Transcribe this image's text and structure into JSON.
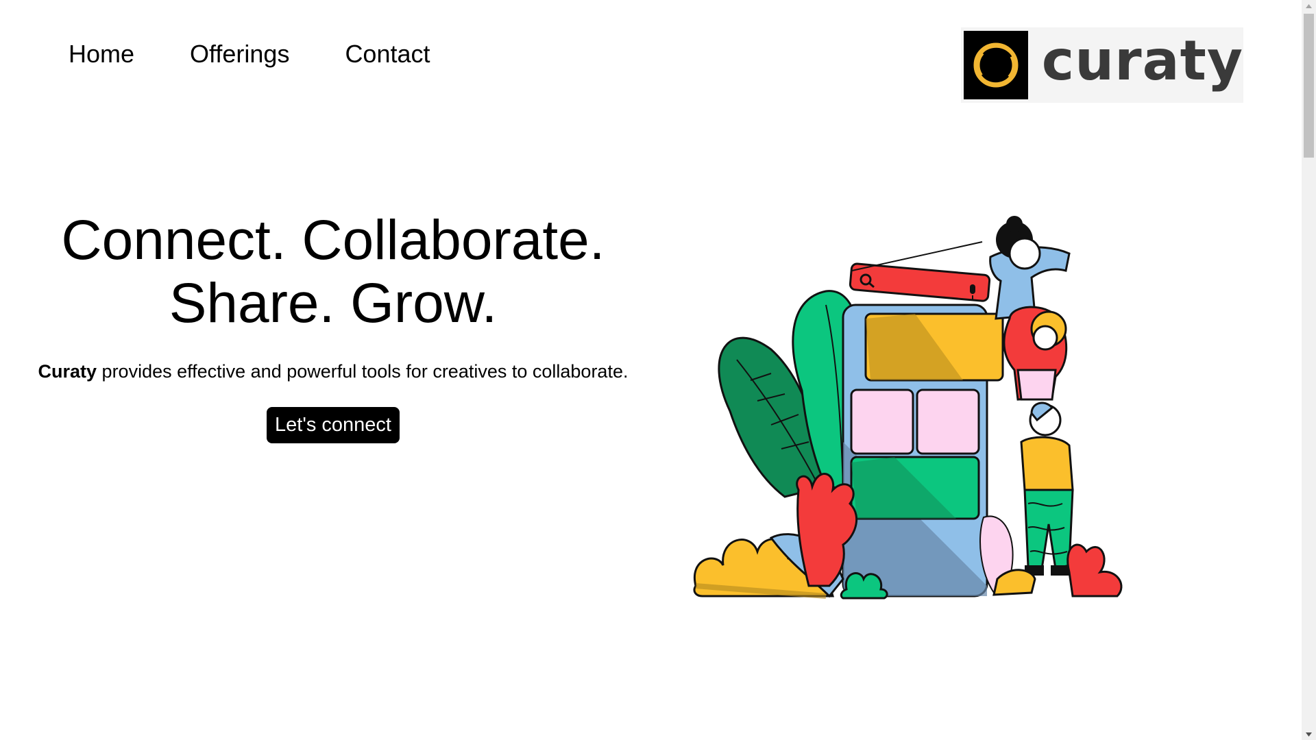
{
  "nav": {
    "items": [
      {
        "label": "Home"
      },
      {
        "label": "Offerings"
      },
      {
        "label": "Contact"
      }
    ]
  },
  "logo": {
    "text": "curaty",
    "mark_icon": "ring-logo-icon",
    "brand_color": "#f2b632"
  },
  "hero": {
    "headline_line1": "Connect. Collaborate.",
    "headline_line2": "Share. Grow.",
    "brand_name": "Curaty",
    "description": " provides effective and powerful tools for creatives to collaborate.",
    "cta_label": "Let's connect"
  },
  "illustration": {
    "name": "team-collaboration-illustration",
    "colors": {
      "yellow": "#fbbf2c",
      "red": "#f33b3b",
      "green": "#0cc67f",
      "dark_green": "#108a55",
      "blue": "#8fbfe8",
      "pink": "#fdd4ef"
    }
  }
}
